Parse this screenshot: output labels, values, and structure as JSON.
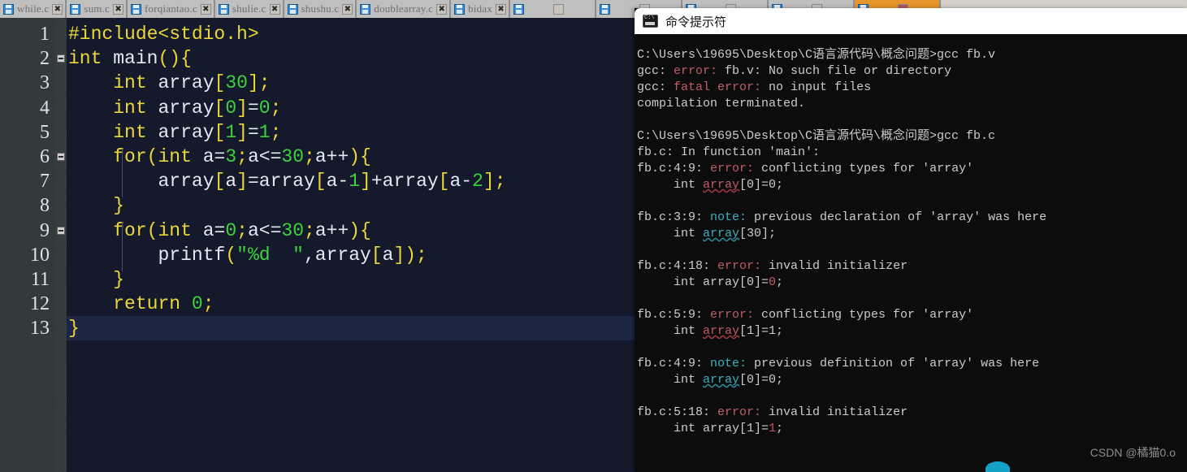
{
  "editor": {
    "tabs": [
      {
        "label": "while.c",
        "icon": "floppy-disk-icon",
        "close": "✖",
        "active": false
      },
      {
        "label": "sum.c",
        "icon": "floppy-disk-icon",
        "close": "✖",
        "active": false
      },
      {
        "label": "forqiantao.c",
        "icon": "floppy-disk-icon",
        "close": "✖",
        "active": false
      },
      {
        "label": "shulie.c",
        "icon": "floppy-disk-icon",
        "close": "✖",
        "active": false
      },
      {
        "label": "shushu.c",
        "icon": "floppy-disk-icon",
        "close": "✖",
        "active": false
      },
      {
        "label": "doublearray.c",
        "icon": "floppy-disk-icon",
        "close": "✖",
        "active": false
      },
      {
        "label": "bidax",
        "icon": "floppy-disk-icon",
        "close": "✖",
        "active": false
      },
      {
        "label": "",
        "icon": "floppy-disk-icon",
        "close": "",
        "active": false
      },
      {
        "label": "",
        "icon": "floppy-disk-icon",
        "close": "",
        "active": false
      },
      {
        "label": "",
        "icon": "floppy-disk-icon",
        "close": "",
        "active": false
      },
      {
        "label": "",
        "icon": "floppy-disk-icon",
        "close": "",
        "active": false
      },
      {
        "label": "",
        "icon": "floppy-disk-icon",
        "close": "",
        "active": true
      }
    ],
    "line_numbers": [
      "1",
      "2",
      "3",
      "4",
      "5",
      "6",
      "7",
      "8",
      "9",
      "10",
      "11",
      "12",
      "13"
    ],
    "fold_lines": [
      2,
      6,
      9
    ],
    "current_line": 13,
    "code_lines": [
      "#include<stdio.h>",
      "int main(){",
      "    int array[30];",
      "    int array[0]=0;",
      "    int array[1]=1;",
      "    for(int a=3;a<=30;a++){",
      "        array[a]=array[a-1]+array[a-2];",
      "    }",
      "    for(int a=0;a<=30;a++){",
      "        printf(\"%d  \",array[a]);",
      "    }",
      "    return 0;",
      "}"
    ],
    "colors": {
      "background": "#141a2b",
      "gutter": "#323a3c",
      "keyword": "#ebd63b",
      "number": "#3fd23f",
      "string": "#3fd23f",
      "identifier": "#e3eaf2",
      "current_line": "#1d2647"
    }
  },
  "cmd": {
    "title": "命令提示符",
    "icon": "console-icon",
    "prompt_path": "C:\\Users\\19695\\Desktop\\C语言源代码\\概念问题>",
    "commands": [
      "gcc fb.v",
      "gcc fb.c"
    ],
    "colors": {
      "background": "#0c0c0c",
      "text": "#cccccc",
      "error": "#c25b64",
      "note": "#3ab0bf"
    },
    "output_lines": [
      {
        "kind": "prompt",
        "path": "C:\\Users\\19695\\Desktop\\C语言源代码\\概念问题>",
        "cmd": "gcc fb.v"
      },
      {
        "kind": "error",
        "pre": "gcc: ",
        "tag": "error:",
        "post": " fb.v: No such file or directory"
      },
      {
        "kind": "error",
        "pre": "gcc: ",
        "tag": "fatal error:",
        "post": " no input files"
      },
      {
        "kind": "plain",
        "text": "compilation terminated."
      },
      {
        "kind": "blank",
        "text": ""
      },
      {
        "kind": "prompt",
        "path": "C:\\Users\\19695\\Desktop\\C语言源代码\\概念问题>",
        "cmd": "gcc fb.c"
      },
      {
        "kind": "plain",
        "text": "fb.c: In function 'main':"
      },
      {
        "kind": "error",
        "pre": "fb.c:4:9: ",
        "tag": "error:",
        "post": " conflicting types for 'array'"
      },
      {
        "kind": "snippet",
        "indent": "     int ",
        "mark": "array",
        "markcolor": "red",
        "rest": "[0]=0;"
      },
      {
        "kind": "blank",
        "text": ""
      },
      {
        "kind": "note",
        "pre": "fb.c:3:9: ",
        "tag": "note:",
        "post": " previous declaration of 'array' was here"
      },
      {
        "kind": "snippet",
        "indent": "     int ",
        "mark": "array",
        "markcolor": "cyan",
        "rest": "[30];"
      },
      {
        "kind": "blank",
        "text": ""
      },
      {
        "kind": "error",
        "pre": "fb.c:4:18: ",
        "tag": "error:",
        "post": " invalid initializer"
      },
      {
        "kind": "snippet2",
        "indent": "     int array[0]=",
        "mark": "0",
        "markcolor": "red",
        "rest": ";"
      },
      {
        "kind": "blank",
        "text": ""
      },
      {
        "kind": "error",
        "pre": "fb.c:5:9: ",
        "tag": "error:",
        "post": " conflicting types for 'array'"
      },
      {
        "kind": "snippet",
        "indent": "     int ",
        "mark": "array",
        "markcolor": "red",
        "rest": "[1]=1;"
      },
      {
        "kind": "blank",
        "text": ""
      },
      {
        "kind": "note",
        "pre": "fb.c:4:9: ",
        "tag": "note:",
        "post": " previous definition of 'array' was here"
      },
      {
        "kind": "snippet",
        "indent": "     int ",
        "mark": "array",
        "markcolor": "cyan",
        "rest": "[0]=0;"
      },
      {
        "kind": "blank",
        "text": ""
      },
      {
        "kind": "error",
        "pre": "fb.c:5:18: ",
        "tag": "error:",
        "post": " invalid initializer"
      },
      {
        "kind": "snippet2",
        "indent": "     int array[1]=",
        "mark": "1",
        "markcolor": "red",
        "rest": ";"
      }
    ]
  },
  "watermark": "CSDN @橘猫0.o"
}
